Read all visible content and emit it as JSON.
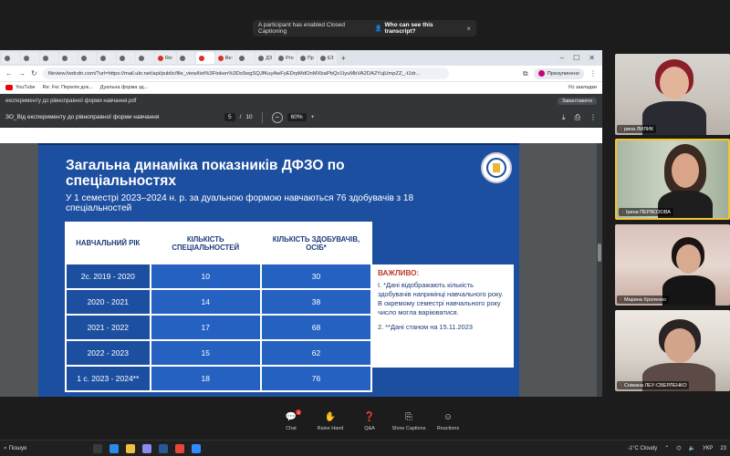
{
  "cc_banner": {
    "message": "A participant has enabled Closed Captioning",
    "link": "Who can see this transcript?",
    "close": "×"
  },
  "browser": {
    "tabs": [
      "",
      "",
      "",
      "",
      "",
      "",
      "",
      "",
      "Re:",
      "",
      "",
      "Re:",
      "",
      "ДЗ",
      "Pro",
      "Пр",
      "ЕЗ"
    ],
    "new_tab": "+",
    "window_controls": [
      "–",
      "☐",
      "✕"
    ],
    "url": "fileview.fwdcdn.com/?url=https://mail.ukr.net/api/public/file_view/list%3Ftoken%3Ds5wgSQJfKuyAwFyEDrpMdOnMXbaPbQv1IyuMbVA2DA2YujUmpZZ_-t1dr...",
    "profile_label": "Призупинено",
    "bookmarks": [
      "YouTube",
      "Re: Fw: Перелік док...",
      "Дуальна форма зд..."
    ],
    "all_bookmarks": "Усі закладки"
  },
  "pdf": {
    "title_bar": "експерименту до рівноправної форми навчання.pdf",
    "download_label": "Завантажити",
    "filename": "ЗО_Від експерименту до рівноправної форми навчання",
    "page_current": "5",
    "page_sep": "/",
    "page_total": "10",
    "zoom_minus": "−",
    "zoom": "60%",
    "zoom_plus": "+"
  },
  "slide": {
    "title": "Загальна динаміка показників ДФЗО по спеціальностях",
    "subtitle": "У 1 семестрі 2023–2024 н. р. за дуальною формою навчаються 76 здобувачів з 18 спеціальностей",
    "table": {
      "headers": [
        "НАВЧАЛЬНИЙ РІК",
        "КІЛЬКІСТЬ СПЕЦІАЛЬНОСТЕЙ",
        "КІЛЬКІСТЬ ЗДОБУВАЧІВ, ОСІБ*"
      ],
      "rows": [
        [
          "2с. 2019 - 2020",
          "10",
          "30"
        ],
        [
          "2020 - 2021",
          "14",
          "38"
        ],
        [
          "2021 - 2022",
          "17",
          "68"
        ],
        [
          "2022 - 2023",
          "15",
          "62"
        ],
        [
          "1 с. 2023 - 2024**",
          "18",
          "76"
        ]
      ]
    },
    "note": {
      "heading": "ВАЖЛИВО:",
      "p1": "I. *Дані відображають кількість здобувачів наприкінці навчального року. В окремому семестрі навчального року число могла варіюватися.",
      "p2": "2. **Дані станом на 15.11.2023"
    }
  },
  "participants": [
    {
      "name": "рина ЛИЛИК"
    },
    {
      "name": "Ірина ПЕРВОЗОВА"
    },
    {
      "name": "Марина Хроленко"
    },
    {
      "name": "Сніжана ЛЕУ-СВЕРЛЕНКО"
    }
  ],
  "meeting_toolbar": [
    {
      "label": "Chat",
      "icon": "chat-icon",
      "badge": "1"
    },
    {
      "label": "Raise Hand",
      "icon": "hand-icon"
    },
    {
      "label": "Q&A",
      "icon": "qa-icon"
    },
    {
      "label": "Show Captions",
      "icon": "cc-icon"
    },
    {
      "label": "Reactions",
      "icon": "reaction-icon"
    }
  ],
  "taskbar": {
    "search": "Пошук",
    "weather": "-1°C Cloudy",
    "lang": "УКР",
    "time": "23"
  }
}
